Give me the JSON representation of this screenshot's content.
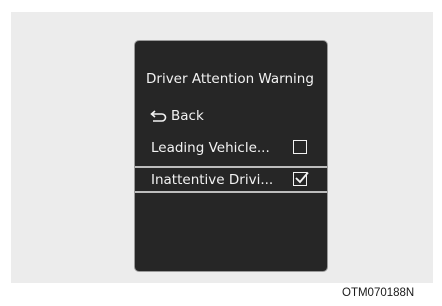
{
  "screen": {
    "title": "Driver Attention Warning",
    "back_label": "Back",
    "back_icon": "return-arrow-icon",
    "items": [
      {
        "label": "Leading Vehicle...",
        "checked": false,
        "selected": false
      },
      {
        "label": "Inattentive Drivi...",
        "checked": true,
        "selected": true
      }
    ]
  },
  "caption": "OTM070188N"
}
